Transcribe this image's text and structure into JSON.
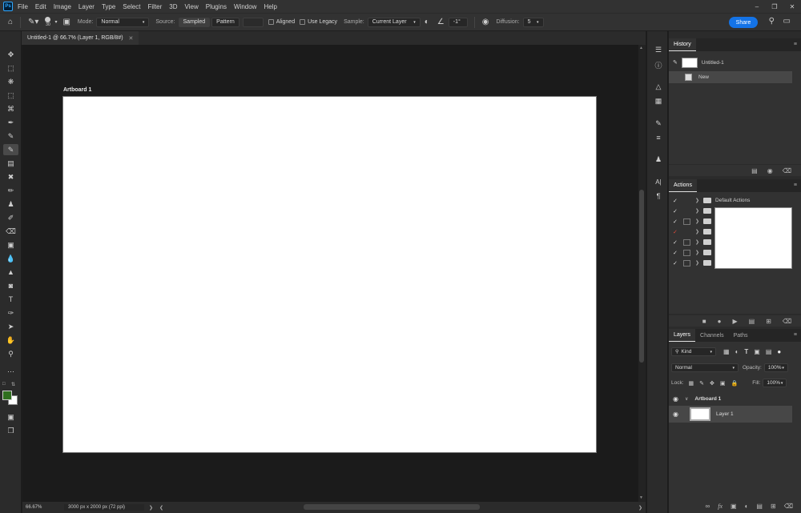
{
  "app": {
    "logo": "Ps"
  },
  "menu": [
    "File",
    "Edit",
    "Image",
    "Layer",
    "Type",
    "Select",
    "Filter",
    "3D",
    "View",
    "Plugins",
    "Window",
    "Help"
  ],
  "window_controls": [
    "minimize-icon",
    "restore-icon",
    "close-icon"
  ],
  "options": {
    "brush_size": "30",
    "mode_label": "Mode:",
    "mode_value": "Normal",
    "source_label": "Source:",
    "source_sampled": "Sampled",
    "source_pattern": "Pattern",
    "aligned_label": "Aligned",
    "legacy_label": "Use Legacy",
    "sample_label": "Sample:",
    "sample_value": "Current Layer",
    "angle_value": "-1°",
    "diffusion_label": "Diffusion:",
    "diffusion_value": "5",
    "share_label": "Share"
  },
  "document": {
    "tab_title": "Untitled-1 @ 66.7% (Layer 1, RGB/8#)",
    "artboard_label": "Artboard 1"
  },
  "status": {
    "zoom": "66.67%",
    "dimensions": "3000 px x 2000 px (72 ppi)"
  },
  "history": {
    "title": "History",
    "snapshot": "Untitled-1",
    "state": "New"
  },
  "actions": {
    "title": "Actions",
    "set_name": "Default Actions",
    "row_count": 7
  },
  "layers": {
    "tabs": [
      "Layers",
      "Channels",
      "Paths"
    ],
    "kind_label": "Kind",
    "blend_mode": "Normal",
    "opacity_label": "Opacity:",
    "opacity_value": "100%",
    "lock_label": "Lock:",
    "fill_label": "Fill:",
    "fill_value": "100%",
    "items": [
      {
        "name": "Artboard 1"
      },
      {
        "name": "Layer 1"
      }
    ]
  },
  "colors": {
    "foreground": "#2f6e1f",
    "background": "#ffffff",
    "accent": "#1473e6"
  }
}
